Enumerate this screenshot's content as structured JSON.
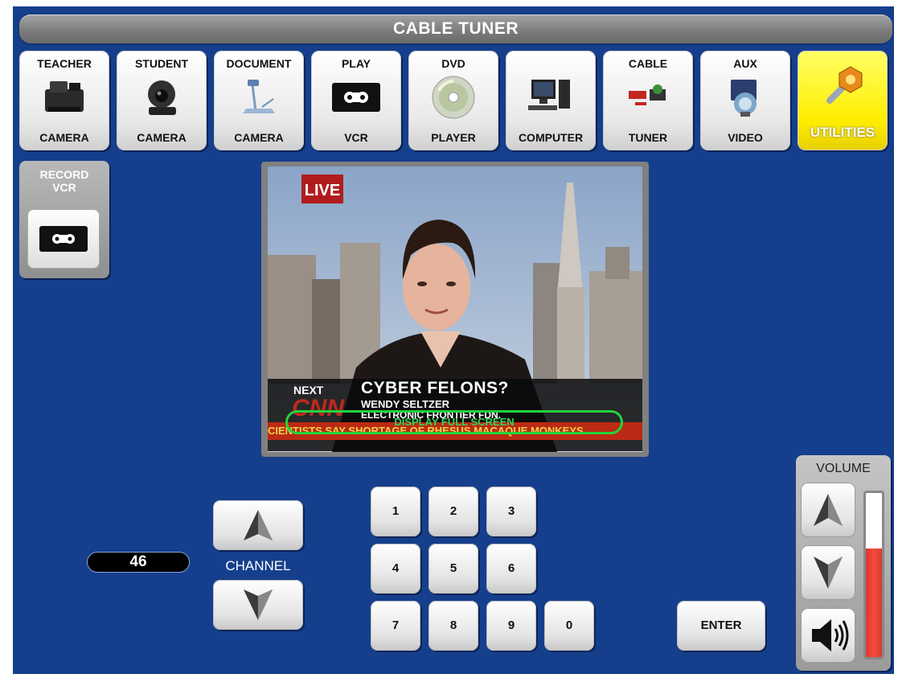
{
  "title": "CABLE TUNER",
  "sources": [
    {
      "top": "TEACHER",
      "bottom": "CAMERA",
      "icon": "document-camera-icon"
    },
    {
      "top": "STUDENT",
      "bottom": "CAMERA",
      "icon": "ptz-camera-icon"
    },
    {
      "top": "DOCUMENT",
      "bottom": "CAMERA",
      "icon": "visualizer-camera-icon"
    },
    {
      "top": "PLAY",
      "bottom": "VCR",
      "icon": "vhs-tape-icon"
    },
    {
      "top": "DVD",
      "bottom": "PLAYER",
      "icon": "dvd-disc-icon"
    },
    {
      "top": "",
      "bottom": "COMPUTER",
      "icon": "computer-icon"
    },
    {
      "top": "CABLE",
      "bottom": "TUNER",
      "icon": "cable-channels-icon"
    },
    {
      "top": "AUX",
      "bottom": "VIDEO",
      "icon": "aux-video-icon"
    },
    {
      "top": "",
      "bottom": "UTILITIES",
      "icon": "wrench-nut-icon",
      "active": true
    }
  ],
  "record": {
    "label_line1": "RECORD",
    "label_line2": "VCR"
  },
  "video": {
    "live_badge": "LIVE",
    "next_tag": "NEXT",
    "headline": "CYBER FELONS?",
    "name": "WENDY SELTZER",
    "org": "ELECTRONIC FRONTIER FDN.",
    "network": "CNN",
    "ticker": "CIENTISTS SAY SHORTAGE OF RHESUS MACAQUE MONKEYS",
    "full_screen_label": "DISPLAY FULL SCREEN"
  },
  "channel": {
    "label": "CHANNEL",
    "number": "46"
  },
  "keypad": {
    "keys": [
      "1",
      "2",
      "3",
      "4",
      "5",
      "6",
      "7",
      "8",
      "9",
      "0"
    ],
    "enter": "ENTER"
  },
  "volume": {
    "label": "VOLUME",
    "level": 0.66
  },
  "colors": {
    "background": "#153f8c",
    "active_source": "#ffee00",
    "volume_fill": "#f44b3c",
    "full_screen_outline": "#22d43b"
  }
}
